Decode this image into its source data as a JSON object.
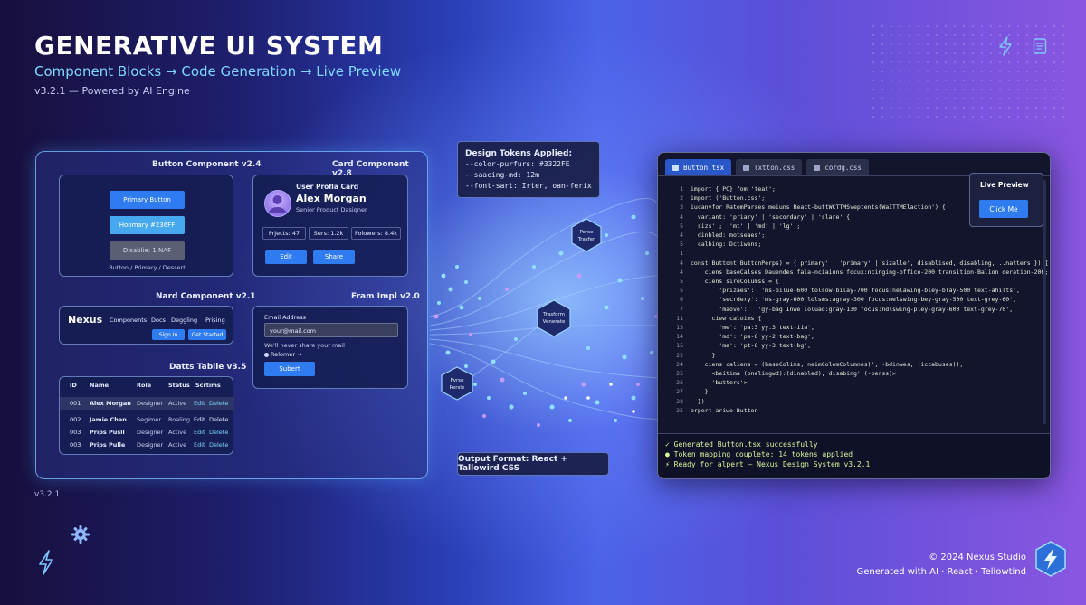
{
  "header": {
    "title": "GENERATIVE UI SYSTEM",
    "subtitle": "Component Blocks → Code Generation → Live Preview",
    "version": "v3.2.1 — Powered by AI Engine"
  },
  "top_icons": [
    "lightning-icon",
    "document-icon"
  ],
  "components": {
    "button": {
      "label": "Button Component v2.4",
      "primary": "Primary Button",
      "second": "Hoomary #236FF",
      "disabled": "Disablie: 1 NAF",
      "caption": "Button / Primary / Dessert"
    },
    "card": {
      "label": "Card Component v2.8",
      "heading": "User Profla Card",
      "name": "Alex Morgan",
      "role": "Senior Product Dasigner",
      "stats": [
        "Prjects: 47",
        "Surs: 1.2k",
        "Folowers: 8.4k"
      ],
      "edit": "Edit",
      "share": "Share"
    },
    "nav": {
      "label": "Nard Component v2.1",
      "brand": "Nexus",
      "links": [
        "Components",
        "Docs",
        "Deggling",
        "Prising"
      ],
      "signin": "Sign In",
      "getstarted": "Get Started"
    },
    "form": {
      "label": "Fram Impl v2.0",
      "field_label": "Email Address",
      "field_value": "your@mail.com",
      "helper": "We'll never share your mail",
      "remember": "Relomer →",
      "submit": "Subert"
    },
    "table": {
      "label": "Datts Tablle v3.5",
      "headers": [
        "ID",
        "Name",
        "Role",
        "Status",
        "Scrtims"
      ],
      "rows": [
        [
          "001",
          "Alex Morgan",
          "Designer",
          "Active"
        ],
        [
          "002",
          "Jamie Chan",
          "Segimer",
          "Roaling"
        ],
        [
          "003",
          "Prips Pusll",
          "Designer",
          "Active"
        ],
        [
          "003",
          "Prips Pulle",
          "Designer",
          "Active"
        ]
      ],
      "edit": "Edit",
      "delete": "Delete"
    }
  },
  "tokens": {
    "title": "Design Tokens Applied:",
    "lines": [
      "--color-purfurs: #3322FE",
      "--saacing-md: 12m",
      "--font-sart: Irter, oan-ferix"
    ]
  },
  "flow_nodes": {
    "top": [
      "Perse",
      "Trasfer"
    ],
    "center": [
      "Trasform",
      "Venerate"
    ],
    "bottom": [
      "Pvrse",
      "Persle"
    ]
  },
  "output_format": "Output Format: React + Tallowird CSS",
  "editor": {
    "tabs": [
      "Button.tsx",
      "lxtton.css",
      "cordg.css"
    ],
    "lines": [
      [
        "1",
        "import { PC} fom 'teat';"
      ],
      [
        "2",
        "import ('Button.css';"
      ],
      [
        "3",
        "iucanvfor RatomParses meiuns React-buttWCTTMSveptents(WaITTMElaction') {"
      ],
      [
        "4",
        "  variant: 'priary' | 'secordary' | 'slare' {"
      ],
      [
        "5",
        "  sizs' ;  'mt' | 'md' | 'lg' ;"
      ],
      [
        "4",
        "  dinbled: motseaes';"
      ],
      [
        "5",
        "  calbing: Dctiwens;"
      ],
      [
        "1",
        ""
      ],
      [
        "4",
        "const Buttont ButtonPerps) = { primary' | 'primary' | sizalle', disablised, disablimg, ..natters }) {"
      ],
      [
        "4",
        "    ciens baseCalses Dauendes fala-nciaiuns focux:ncinging-office-200 transition-Balion deration-206;"
      ],
      [
        "5",
        "    ciens sireColumss = {"
      ],
      [
        "5",
        "        'prizaes':  'ms-bilue-600 tolsow-bilay-700 focus:nelawing-bley-blay-500 text-ahilts',"
      ],
      [
        "6",
        "        'secrdery': 'ms-gray-600 lolsms:agray-300 focus:melswing-bey-gray-500 text-grey-60',"
      ],
      [
        "7",
        "        'maovo':   'gy-bag Inwe loluad:gray-130 focus:ndlswing-pley-gray-600 text-grey-70',"
      ],
      [
        "11",
        "      ciew caloims {"
      ],
      [
        "13",
        "        'me': 'pa:3 yy.3 text-iia',"
      ],
      [
        "14",
        "        'md': 'ps-6 yy-2 text-bag',"
      ],
      [
        "15",
        "        'me': 'pt-6 yy-3 text-bg',"
      ],
      [
        "22",
        "      }"
      ],
      [
        "24",
        "    ciens caliens = (baseColims, neimColemColumnes)', -bdinwes, (iccabuses));"
      ],
      [
        "25",
        "      <beitima (bnelingwd):(dinabled); disabing' (-perss)>"
      ],
      [
        "26",
        "      'butters'>"
      ],
      [
        "27",
        "    }"
      ],
      [
        "28",
        "  })"
      ],
      [
        "25",
        "erpert ariwe Button"
      ]
    ],
    "live_preview_label": "Live Preview",
    "live_button": "Click Me",
    "terminal": [
      "✓ Generated Button.tsx successfully",
      "● Token mapping couplete: 14 tokens applied",
      "⚡ Ready for alpert — Nexus Design System v3.2.1"
    ]
  },
  "footer": {
    "copyright": "© 2024 Nexus Studio",
    "generated": "Generated with AI · React · Tellowtind",
    "version": "v3.2.1"
  },
  "colors": {
    "accent": "#2f7bf0",
    "cyan": "#7fd6ff",
    "terminal_green": "#d8f5a0"
  }
}
